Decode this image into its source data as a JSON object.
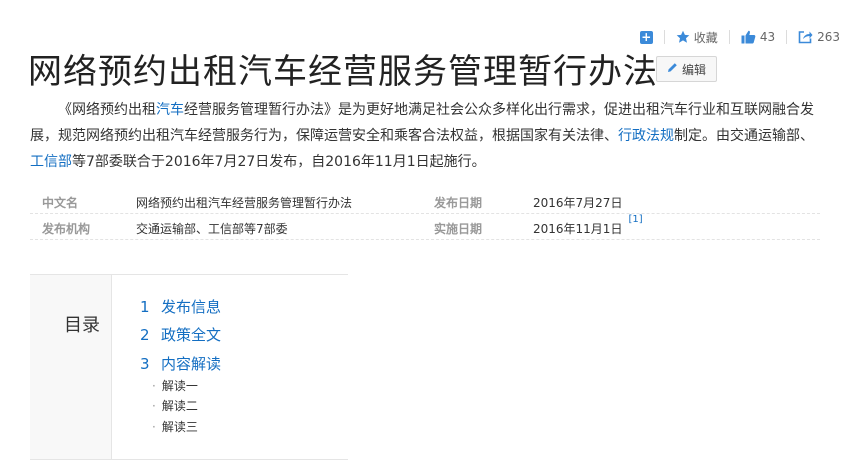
{
  "actions": {
    "favorite_label": "收藏",
    "like_count": "43",
    "share_count": "263"
  },
  "title": "网络预约出租汽车经营服务管理暂行办法",
  "edit_label": "编辑",
  "summary": {
    "p1": "《网络预约出租",
    "link1": "汽车",
    "p2": "经营服务管理暂行办法》是为更好地满足社会公众多样化出行需求，促进出租汽车行业和互联网融合发展，规范网络预约出租汽车经营服务行为，保障运营安全和乘客合法权益，根据国家有关法律、",
    "link2": "行政法规",
    "p3": "制定。由交通运输部、",
    "link3": "工信部",
    "p4": "等7部委联合于2016年7月27日发布，自2016年11月1日起施行。"
  },
  "info": {
    "row1": {
      "label1": "中文名",
      "value1": "网络预约出租汽车经营服务管理暂行办法",
      "label2": "发布日期",
      "value2": "2016年7月27日"
    },
    "row2": {
      "label1": "发布机构",
      "value1": "交通运输部、工信部等7部委",
      "label2": "实施日期",
      "value2": "2016年11月1日",
      "ref": "[1]"
    }
  },
  "catalog": {
    "title": "目录",
    "items": [
      {
        "num": "1",
        "label": "发布信息"
      },
      {
        "num": "2",
        "label": "政策全文"
      },
      {
        "num": "3",
        "label": "内容解读"
      }
    ],
    "subs": [
      "解读一",
      "解读二",
      "解读三"
    ]
  },
  "colors": {
    "link": "#136ec2",
    "accent": "#3b8ad9",
    "icon": "#3b8ad9"
  }
}
